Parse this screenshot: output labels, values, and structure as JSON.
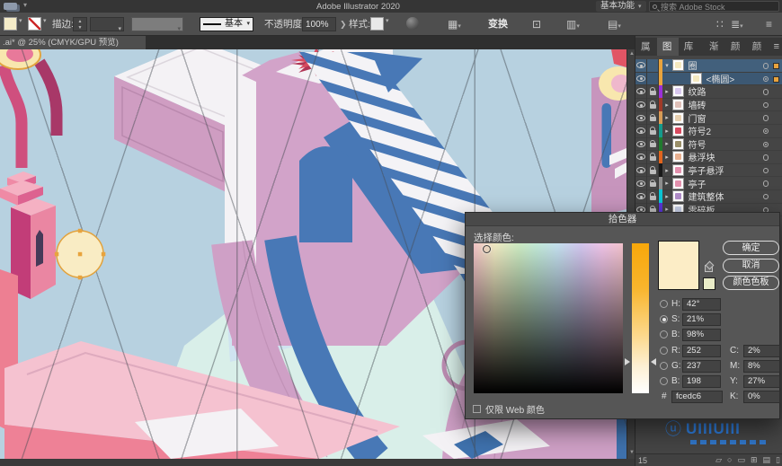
{
  "menubar": {
    "app_title": "Adobe Illustrator 2020",
    "workspace": "基本功能",
    "search_placeholder": "搜索 Adobe Stock"
  },
  "controlbar": {
    "stroke_label": "描边:",
    "width_profile": "基本",
    "opacity_label": "不透明度:",
    "opacity_value": "100%",
    "style_label": "样式:",
    "transform_label": "变换"
  },
  "tabbar": {
    "document_tab": ".ai* @ 25% (CMYK/GPU 预览)"
  },
  "panel": {
    "tabs": [
      {
        "label": "属性"
      },
      {
        "label": "图层"
      },
      {
        "label": "库"
      }
    ],
    "tabs_secondary": [
      {
        "label": "渐变"
      },
      {
        "label": "颜色"
      },
      {
        "label": "颜色参"
      }
    ],
    "layers": [
      {
        "name": "圈",
        "color": "#e8a33d",
        "thumb": "#f5e9c0",
        "locked": false,
        "selected": true,
        "child": false,
        "chevron": "▾",
        "target": "ring",
        "indicator": true
      },
      {
        "name": "<椭圆>",
        "color": "#e8a33d",
        "thumb": "#f5e9c0",
        "locked": false,
        "selected": true,
        "child": true,
        "chevron": "",
        "target": "meatball",
        "indicator": true
      },
      {
        "name": "纹路",
        "color": "#9b30d9",
        "thumb": "#d9c8ef",
        "locked": true,
        "selected": false,
        "child": false,
        "chevron": "▸",
        "target": "ring",
        "indicator": false
      },
      {
        "name": "墙砖",
        "color": "#a03a28",
        "thumb": "#e0c0b8",
        "locked": true,
        "selected": false,
        "child": false,
        "chevron": "▸",
        "target": "ring",
        "indicator": false
      },
      {
        "name": "门窗",
        "color": "#d79b56",
        "thumb": "#e8d0b0",
        "locked": true,
        "selected": false,
        "child": false,
        "chevron": "▸",
        "target": "ring",
        "indicator": false
      },
      {
        "name": "符号2",
        "color": "#159a8c",
        "thumb": "#d84a5f",
        "locked": true,
        "selected": false,
        "child": false,
        "chevron": "▸",
        "target": "meatball",
        "indicator": false
      },
      {
        "name": "符号",
        "color": "#207a2e",
        "thumb": "#9a8f68",
        "locked": true,
        "selected": false,
        "child": false,
        "chevron": "▸",
        "target": "meatball",
        "indicator": false
      },
      {
        "name": "悬浮块",
        "color": "#e0641e",
        "thumb": "#e8b090",
        "locked": true,
        "selected": false,
        "child": false,
        "chevron": "▸",
        "target": "ring",
        "indicator": false
      },
      {
        "name": "亭子悬浮",
        "color": "#1a1a1a",
        "thumb": "#e390ad",
        "locked": true,
        "selected": false,
        "child": false,
        "chevron": "▸",
        "target": "ring",
        "indicator": false
      },
      {
        "name": "亭子",
        "color": "#8e8e8e",
        "thumb": "#e390ad",
        "locked": true,
        "selected": false,
        "child": false,
        "chevron": "▸",
        "target": "ring",
        "indicator": false
      },
      {
        "name": "建筑整体",
        "color": "#0bc4d4",
        "thumb": "#b08cc8",
        "locked": true,
        "selected": false,
        "child": false,
        "chevron": "▸",
        "target": "ring",
        "indicator": false
      },
      {
        "name": "零碎板",
        "color": "#5a35d8",
        "thumb": "#c8d0e8",
        "locked": true,
        "selected": false,
        "child": false,
        "chevron": "▸",
        "target": "ring",
        "indicator": false
      }
    ],
    "footer_count": "15"
  },
  "dialog": {
    "title": "拾色器",
    "select_label": "选择颜色:",
    "buttons": {
      "ok": "确定",
      "cancel": "取消",
      "swatches": "颜色色板"
    },
    "labels": {
      "h": "H:",
      "s": "S:",
      "b": "B:",
      "r": "R:",
      "g": "G:",
      "b2": "B:",
      "hex": "#",
      "c": "C:",
      "m": "M:",
      "y": "Y:",
      "k": "K:"
    },
    "values": {
      "h": "42°",
      "s": "21%",
      "b": "98%",
      "r": "252",
      "g": "237",
      "b2": "198",
      "hex": "fcedc6",
      "c": "2%",
      "m": "8%",
      "y": "27%",
      "k": "0%"
    },
    "selected_channel": "s",
    "web_only_label": "仅限 Web 颜色",
    "current_color": "#fcedc6",
    "slider_top_color": "#f7a70a"
  },
  "watermark": {
    "text": "UIIIUIII"
  }
}
